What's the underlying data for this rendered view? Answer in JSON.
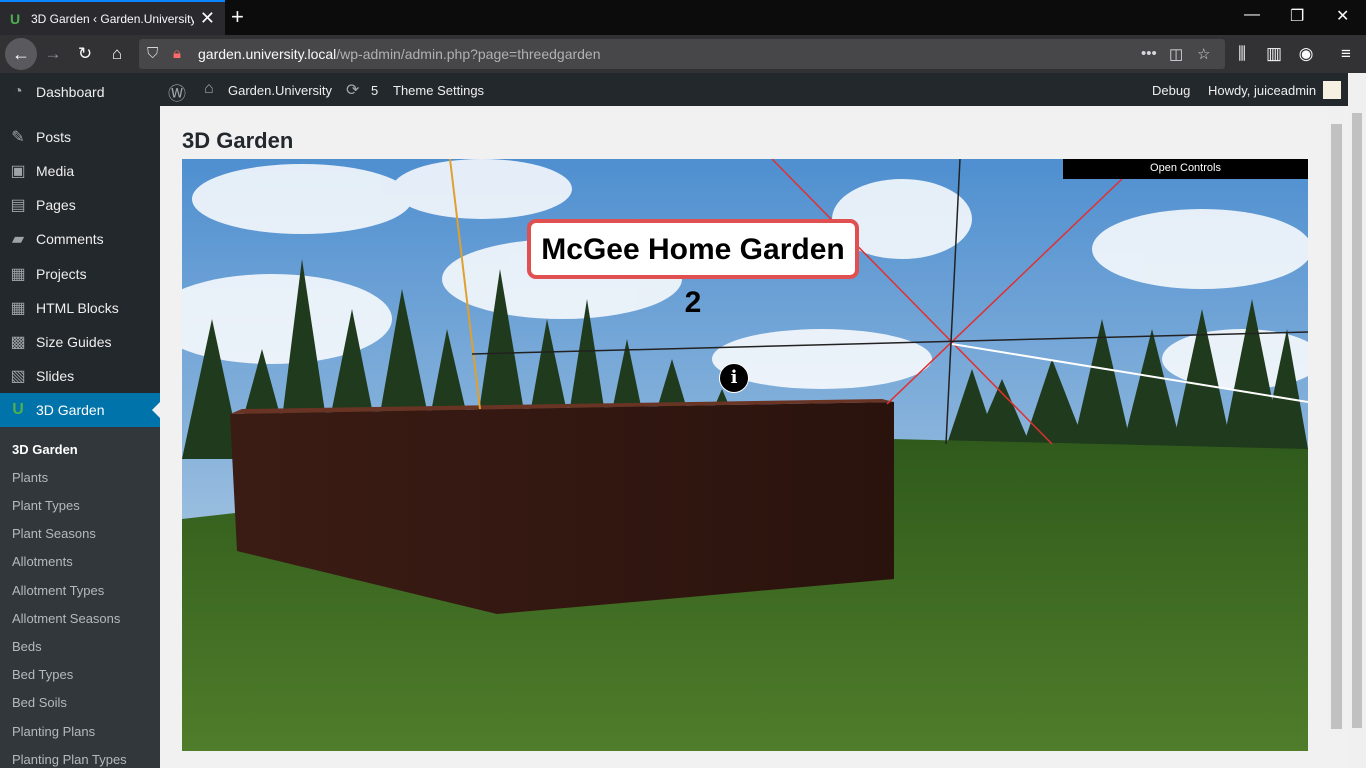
{
  "browser": {
    "tab_title": "3D Garden ‹ Garden.University —",
    "url_host": "garden.university.local",
    "url_path": "/wp-admin/admin.php?page=threedgarden"
  },
  "sidebar": {
    "items": [
      {
        "label": "Dashboard",
        "icon": "dashboard-icon"
      },
      {
        "label": "Posts",
        "icon": "pin-icon"
      },
      {
        "label": "Media",
        "icon": "media-icon"
      },
      {
        "label": "Pages",
        "icon": "pages-icon"
      },
      {
        "label": "Comments",
        "icon": "comment-icon"
      },
      {
        "label": "Projects",
        "icon": "portfolio-icon"
      },
      {
        "label": "HTML Blocks",
        "icon": "grid-icon"
      },
      {
        "label": "Size Guides",
        "icon": "table-icon"
      },
      {
        "label": "Slides",
        "icon": "slides-icon"
      },
      {
        "label": "3D Garden",
        "icon": "garden-icon"
      }
    ],
    "submenu": [
      "3D Garden",
      "Plants",
      "Plant Types",
      "Plant Seasons",
      "Allotments",
      "Allotment Types",
      "Allotment Seasons",
      "Beds",
      "Bed Types",
      "Bed Soils",
      "Planting Plans",
      "Planting Plan Types"
    ]
  },
  "adminbar": {
    "site_name": "Garden.University",
    "updates_count": "5",
    "theme_settings": "Theme Settings",
    "debug": "Debug",
    "howdy": "Howdy, juiceadmin"
  },
  "page": {
    "title": "3D Garden",
    "open_controls": "Open Controls",
    "scene_label": "McGee Home Garden 2",
    "info_glyph": "i"
  },
  "colors": {
    "wp_sidebar": "#23282d",
    "wp_active": "#0073aa",
    "sky": "#6fa6d8",
    "grass": "#3e6b22",
    "brick": "#4a2417"
  }
}
